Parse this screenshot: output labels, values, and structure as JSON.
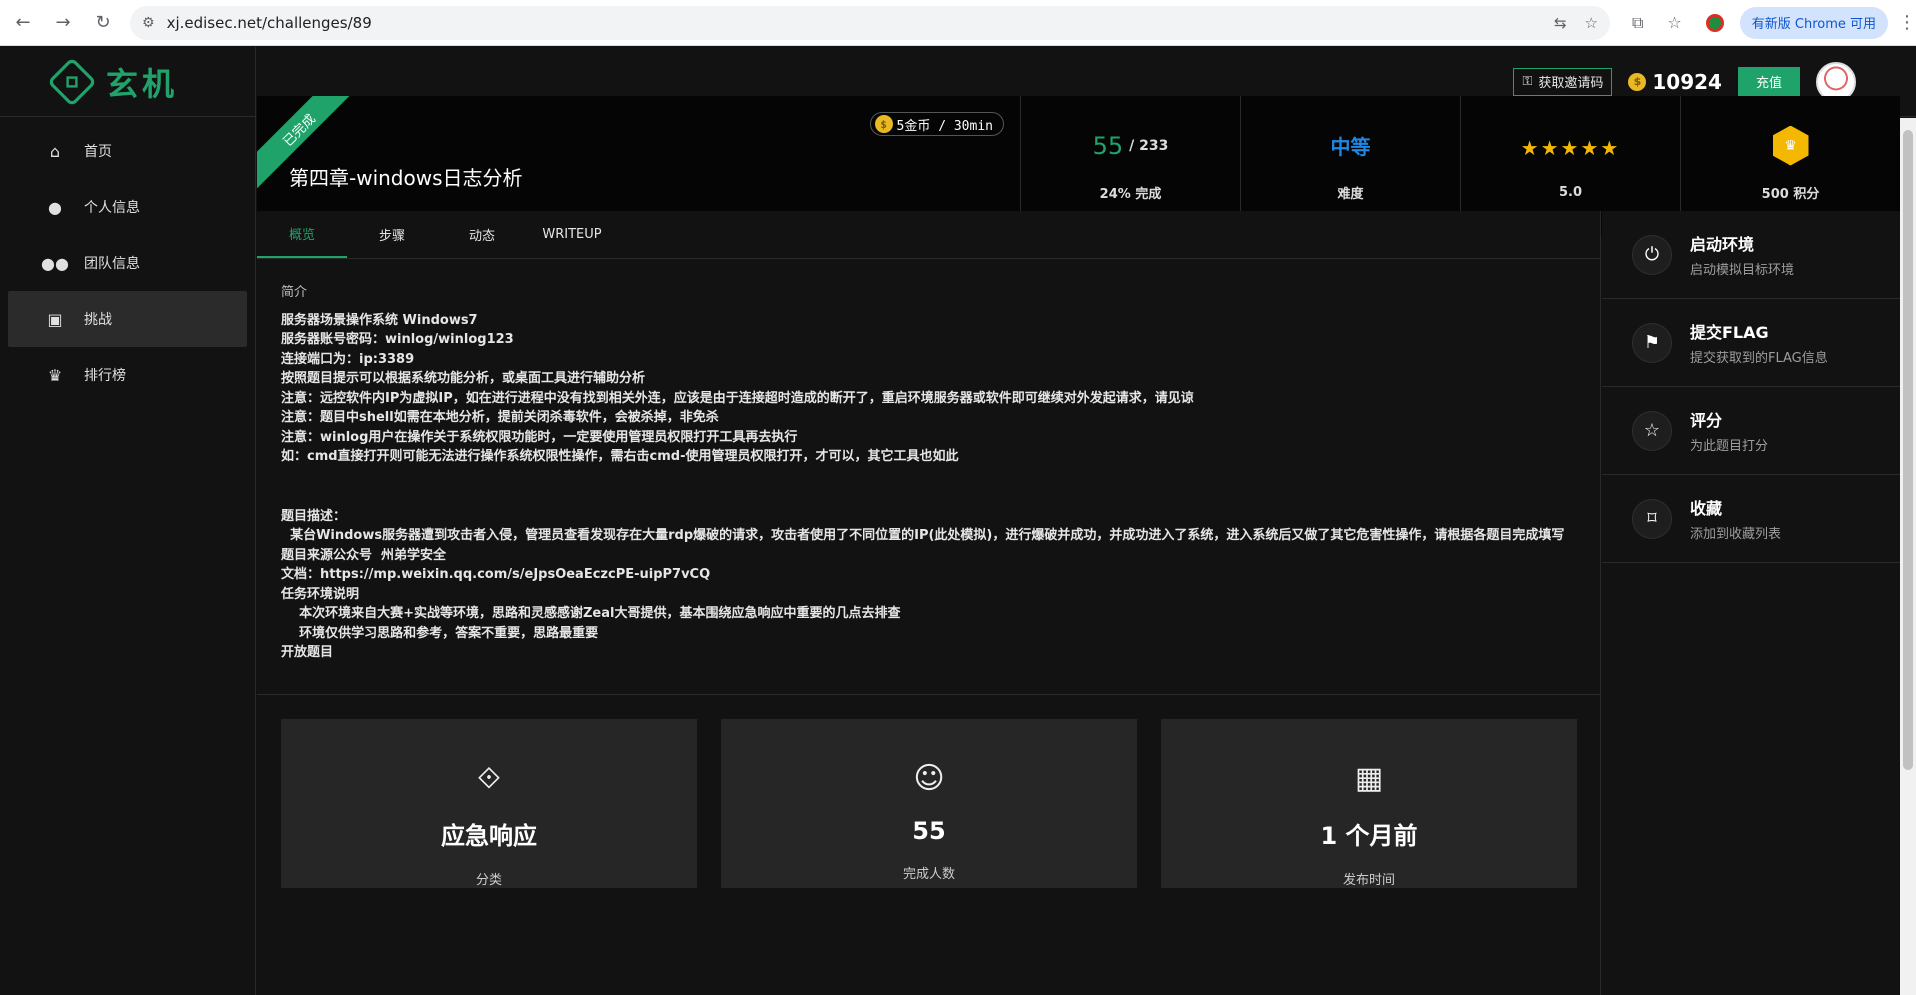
{
  "browser": {
    "url": "xj.edisec.net/challenges/89",
    "update_label": "有新版 Chrome 可用"
  },
  "logo": {
    "text": "玄机"
  },
  "sidebar": {
    "items": [
      {
        "label": "首页",
        "icon": "home-icon"
      },
      {
        "label": "个人信息",
        "icon": "person-icon"
      },
      {
        "label": "团队信息",
        "icon": "group-icon"
      },
      {
        "label": "挑战",
        "icon": "gamepad-icon"
      },
      {
        "label": "排行榜",
        "icon": "trophy-icon"
      }
    ]
  },
  "topbar": {
    "invite_label": "获取邀请码",
    "balance": "10924",
    "recharge_label": "充值"
  },
  "challenge": {
    "ribbon": "已完成",
    "title": "第四章-windows日志分析",
    "cost": "5金币 / 30min",
    "progress_done": "55",
    "progress_total": "/ 233",
    "progress_label": "24% 完成",
    "difficulty": "中等",
    "difficulty_label": "难度",
    "rating_stars": "★★★★★",
    "rating": "5.0",
    "points_label": "500 积分"
  },
  "tabs": [
    {
      "label": "概览"
    },
    {
      "label": "步骤"
    },
    {
      "label": "动态"
    },
    {
      "label": "WRITEUP"
    }
  ],
  "description": {
    "section_label": "简介",
    "intro": "服务器场景操作系统 Windows7\n服务器账号密码：winlog/winlog123\n连接端口为：ip:3389\n按照题目提示可以根据系统功能分析，或桌面工具进行辅助分析\n注意：远控软件内IP为虚拟IP，如在进行进程中没有找到相关外连，应该是由于连接超时造成的断开了，重启环境服务器或软件即可继续对外发起请求，请见谅\n注意：题目中shell如需在本地分析，提前关闭杀毒软件，会被杀掉，非免杀\n注意：winlog用户在操作关于系统权限功能时，一定要使用管理员权限打开工具再去执行\n如：cmd直接打开则可能无法进行操作系统权限性操作，需右击cmd-使用管理员权限打开，才可以，其它工具也如此",
    "body": "题目描述：\n  某台Windows服务器遭到攻击者入侵，管理员查看发现存在大量rdp爆破的请求，攻击者使用了不同位置的IP(此处模拟)，进行爆破并成功，并成功进入了系统，进入系统后又做了其它危害性操作，请根据各题目完成填写\n题目来源公众号  州弟学安全\n文档：https://mp.weixin.qq.com/s/eJpsOeaEczcPE-uipP7vCQ\n任务环境说明\n    本次环境来自大赛+实战等环境，思路和灵感感谢Zeal大哥提供，基本围绕应急响应中重要的几点去排查\n    环境仅供学习思路和参考，答案不重要，思路最重要\n开放题目"
  },
  "cards": [
    {
      "value": "应急响应",
      "label": "分类",
      "icon": "warning-diamond-icon"
    },
    {
      "value": "55",
      "label": "完成人数",
      "icon": "users-icon"
    },
    {
      "value": "1 个月前",
      "label": "发布时间",
      "icon": "calendar-icon"
    }
  ],
  "actions": [
    {
      "title": "启动环境",
      "subtitle": "启动模拟目标环境",
      "icon": "power-icon"
    },
    {
      "title": "提交FLAG",
      "subtitle": "提交获取到的FLAG信息",
      "icon": "flag-icon"
    },
    {
      "title": "评分",
      "subtitle": "为此题目打分",
      "icon": "star-icon"
    },
    {
      "title": "收藏",
      "subtitle": "添加到收藏列表",
      "icon": "bookmark-icon"
    }
  ],
  "colors": {
    "accent": "#1fa36b",
    "difficulty": "#1e88e5",
    "star": "#f5b800"
  }
}
